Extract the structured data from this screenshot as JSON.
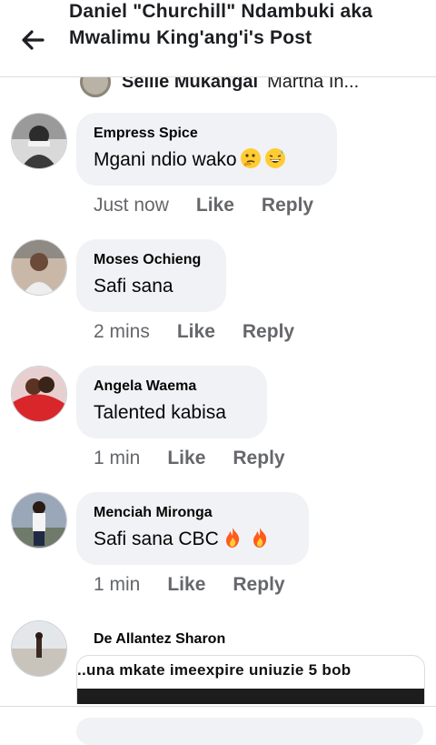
{
  "header": {
    "title": "Daniel \"Churchill\" Ndambuki aka Mwalimu King'ang'i's Post"
  },
  "reply_preview": {
    "name": "Sellie Mukangai",
    "snippet": "Martha In..."
  },
  "comments": [
    {
      "author": "Empress Spice",
      "text": "Mgani ndio wako",
      "emojis": [
        "thinking-face-emoji",
        "grinning-sweat-emoji"
      ],
      "time": "Just now",
      "like": "Like",
      "reply": "Reply"
    },
    {
      "author": "Moses Ochieng",
      "text": "Safi sana",
      "emojis": [],
      "time": "2 mins",
      "like": "Like",
      "reply": "Reply"
    },
    {
      "author": "Angela Waema",
      "text": "Talented kabisa",
      "emojis": [],
      "time": "1 min",
      "like": "Like",
      "reply": "Reply"
    },
    {
      "author": "Menciah Mironga",
      "text": "Safi sana CBC",
      "emojis": [
        "fire-emoji",
        "fire-emoji"
      ],
      "time": "1 min",
      "like": "Like",
      "reply": "Reply"
    }
  ],
  "last_comment": {
    "author": "De Allantez Sharon",
    "image_caption": "..una mkate imeexpire uniuzie 5 bob"
  },
  "colors": {
    "bubble": "#f0f2f5",
    "meta_text": "#65676b",
    "primary_text": "#050505"
  }
}
